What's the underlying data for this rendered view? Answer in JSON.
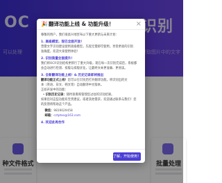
{
  "background": {
    "hero_title_left": "OC",
    "hero_title_right": "R识别",
    "hero_sub_left": "可以处理",
    "hero_sub_right": "格式的文件，精准提取图片中的文字",
    "card_left_title": "种文件格式",
    "card_right_title": "批量处理"
  },
  "modal": {
    "title": "翻译功能上线 & 功能升级！",
    "close_label": "×",
    "greeting": "尊敬的用户，我们很高兴地宣布以下重大更新与未来计划：",
    "s1_head": "1. 高级模型，现已全面开放！",
    "s1_l1": "曾需文字识别建设使用高级模型，先现无需即可使用，享受更高的识别",
    "s1_l2": "准确度，欢迎大家使用体验！",
    "s2_head": "2. 识别质量全面提升！",
    "s2_l1": "我们将OCR识别结构更新行了重大升级，现在每一次识别完成后，系统都",
    "s2_l2": "会自动进行检测、排版与排版优化，让最终文本更准确、更易读。",
    "s3_head": "3. 全新翻译功能上线！& 历史记录即将推出",
    "s3_l1_label": "翻译功能正式上线！",
    "s3_l1_text": "您可以在识别后打开翻译功能，将识别出的文",
    "s3_l2": "本（英语、日文、韩文等）自动翻译中文版本。",
    "s3_l3": "正如开发中的功能：",
    "s3_bullet_label": "识别历史记录：",
    "s3_bullet_text": "随时查看和管理您过往的识别结果。",
    "s3_l4": "如果您对这些功能有宝贵建议，或者其他需求，欢迎通过联系与我们！您",
    "s3_l5": "的反馈将帮助这个产品。",
    "contact_wechat_label": "微信：",
    "contact_wechat_value": "9819029458",
    "contact_email_label": "邮箱：",
    "contact_email_value": "cctptse@163.com",
    "s4_head": "4. 欢迎此再合作",
    "confirm_label": "了解，开始使用！"
  }
}
